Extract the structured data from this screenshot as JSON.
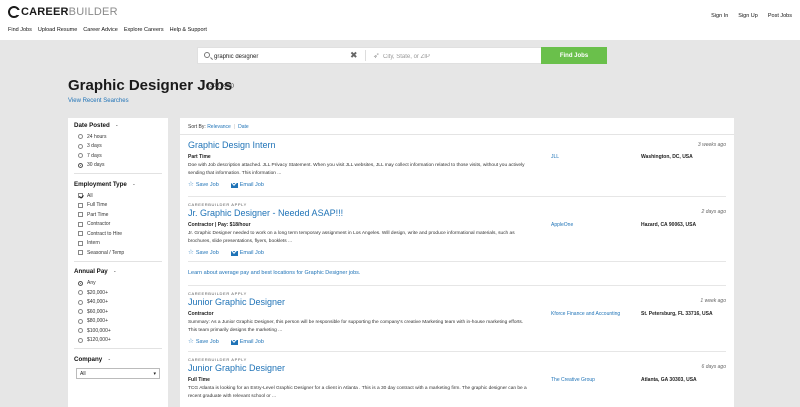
{
  "header": {
    "logo_career": "CAREER",
    "logo_builder": "BUILDER",
    "nav": [
      "Find Jobs",
      "Upload Resume",
      "Career Advice",
      "Explore Careers",
      "Help & Support"
    ],
    "account": [
      "Sign In",
      "Sign Up",
      "Post Jobs"
    ]
  },
  "search": {
    "keyword_value": "graphic designer",
    "location_placeholder": "City, State, or ZIP",
    "find_label": "Find Jobs"
  },
  "page": {
    "title": "Graphic Designer Jobs",
    "count": "(300 Jobs)",
    "recent_link": "View Recent Searches"
  },
  "filters": {
    "date_posted": {
      "label": "Date Posted",
      "options": [
        "24 hours",
        "3 days",
        "7 days",
        "30 days"
      ],
      "selected": "30 days"
    },
    "employment_type": {
      "label": "Employment Type",
      "options": [
        "All",
        "Full Time",
        "Part Time",
        "Contractor",
        "Contract to Hire",
        "Intern",
        "Seasonal / Temp"
      ],
      "selected": "All"
    },
    "annual_pay": {
      "label": "Annual Pay",
      "options": [
        "Any",
        "$20,000+",
        "$40,000+",
        "$60,000+",
        "$80,000+",
        "$100,000+",
        "$120,000+"
      ],
      "selected": "Any"
    },
    "company": {
      "label": "Company",
      "selected": "All"
    }
  },
  "sort": {
    "label": "Sort By:",
    "options": [
      "Relevance",
      "Date"
    ]
  },
  "jobs": [
    {
      "apply_tag": "",
      "title": "Graphic Design Intern",
      "age": "3 weeks ago",
      "type": "Part Time",
      "description": "Doe with Job description attached. JLL Privacy Statement. When you visit JLL websites, JLL may collect information related to those visits, without you actively sending that information. This information ...",
      "company": "JLL",
      "location": "Washington, DC, USA",
      "save_label": "Save Job",
      "email_label": "Email Job"
    },
    {
      "apply_tag": "CAREERBUILDER APPLY",
      "title": "Jr. Graphic Designer - Needed ASAP!!!",
      "age": "2 days ago",
      "type": "Contractor | Pay: $18/hour",
      "description": "Jr. Graphic Designer needed to work on a long term temporary assignment in Los Angeles. Will design, write and produce informational materials, such as brochures, slide presentations, flyers, booklets ...",
      "company": "AppleOne",
      "location": "Hazard, CA 90063, USA",
      "save_label": "Save Job",
      "email_label": "Email Job"
    },
    {
      "apply_tag": "CAREERBUILDER APPLY",
      "title": "Junior Graphic Designer",
      "age": "1 week ago",
      "type": "Contractor",
      "description": "Summary: As a Junior Graphic Designer, this person will be responsible for supporting the company's creative Marketing team with in-house marketing efforts. This team primarily designs the marketing ...",
      "company": "Kforce Finance and Accounting",
      "location": "St. Petersburg, FL 33716, USA",
      "save_label": "Save Job",
      "email_label": "Email Job"
    },
    {
      "apply_tag": "CAREERBUILDER APPLY",
      "title": "Junior Graphic Designer",
      "age": "6 days ago",
      "type": "Full Time",
      "description": "TCG Atlanta is looking for an Entry-Level Graphic Designer for a client in Atlanta . This is a 30 day contract with a marketing firm. The graphic designer can be a recent graduate with relevant school or ...",
      "company": "The Creative Group",
      "location": "Atlanta, GA 30303, USA",
      "save_label": "Save Job",
      "email_label": "Email Job"
    }
  ],
  "learn_more": "Learn about average pay and best locations for Graphic Designer jobs.",
  "colors": {
    "brand_link": "#1f73b7",
    "find_button": "#6ac04b",
    "page_bg": "#e6e6e6"
  }
}
